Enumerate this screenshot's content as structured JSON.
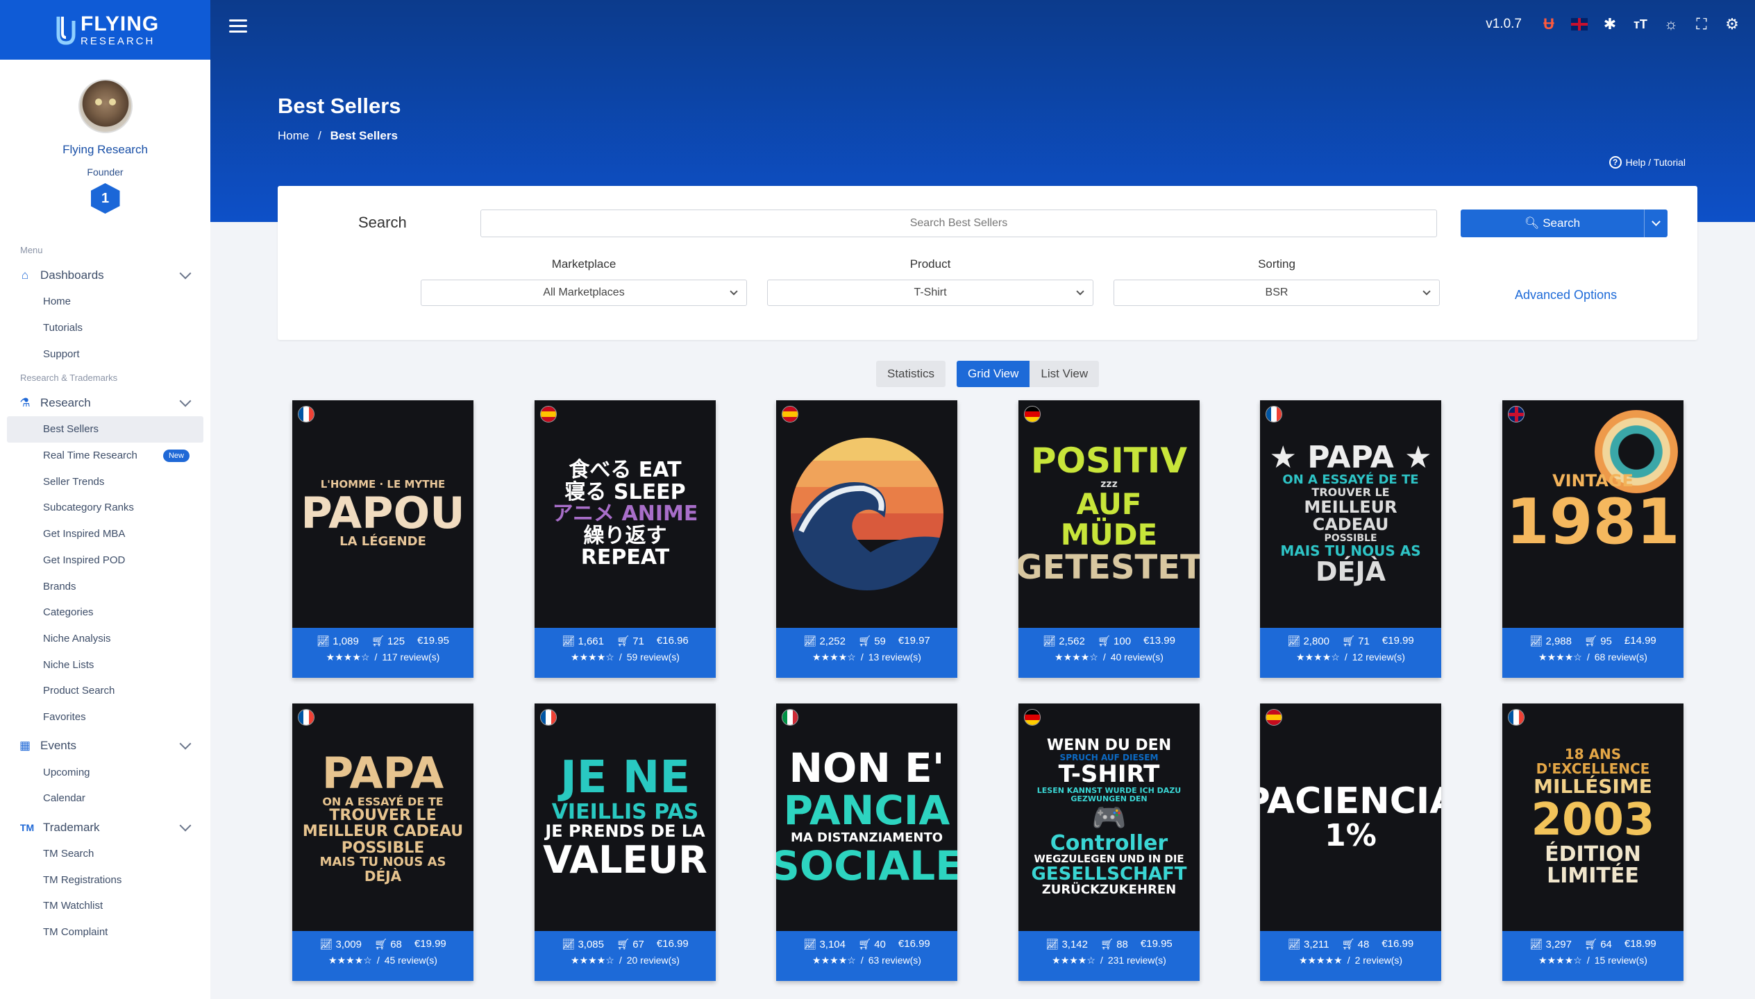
{
  "brand": {
    "line1": "FLYING",
    "line2": "RESEARCH"
  },
  "profile": {
    "name": "Flying Research",
    "role": "Founder",
    "level": "1"
  },
  "sidebar": {
    "menu_caption": "Menu",
    "dashboards": {
      "label": "Dashboards",
      "items": [
        "Home",
        "Tutorials",
        "Support"
      ]
    },
    "research_caption": "Research & Trademarks",
    "research": {
      "label": "Research",
      "items": [
        "Best Sellers",
        "Real Time Research",
        "Seller Trends",
        "Subcategory Ranks",
        "Get Inspired MBA",
        "Get Inspired POD",
        "Brands",
        "Categories",
        "Niche Analysis",
        "Niche Lists",
        "Product Search",
        "Favorites"
      ],
      "new_badge": "New"
    },
    "events": {
      "label": "Events",
      "items": [
        "Upcoming",
        "Calendar"
      ]
    },
    "trademark": {
      "icon": "TM",
      "label": "Trademark",
      "items": [
        "TM Search",
        "TM Registrations",
        "TM Watchlist",
        "TM Complaint"
      ]
    }
  },
  "topbar": {
    "version": "v1.0.7"
  },
  "page": {
    "title": "Best Sellers",
    "breadcrumb_home": "Home",
    "breadcrumb_sep": "/",
    "breadcrumb_current": "Best Sellers",
    "help": "Help / Tutorial"
  },
  "search": {
    "label": "Search",
    "placeholder": "Search Best Sellers",
    "button": "Search",
    "marketplace_label": "Marketplace",
    "marketplace_value": "All Marketplaces",
    "product_label": "Product",
    "product_value": "T-Shirt",
    "sorting_label": "Sorting",
    "sorting_value": "BSR",
    "advanced": "Advanced Options"
  },
  "views": {
    "statistics": "Statistics",
    "grid": "Grid View",
    "list": "List View"
  },
  "products": [
    {
      "flag": "fr",
      "bsr": "1,089",
      "sales": "125",
      "price": "€19.95",
      "stars": "★★★★☆",
      "reviews": "117 review(s)",
      "art": [
        "L'HOMME · LE MYTHE",
        "PAPOU",
        "LA LÉGENDE"
      ]
    },
    {
      "flag": "es",
      "bsr": "1,661",
      "sales": "71",
      "price": "€16.96",
      "stars": "★★★★☆",
      "reviews": "59 review(s)",
      "art": [
        "食べる EAT",
        "寝る SLEEP",
        "アニメ ANIME",
        "繰り返す REPEAT"
      ]
    },
    {
      "flag": "es",
      "bsr": "2,252",
      "sales": "59",
      "price": "€19.97",
      "stars": "★★★★☆",
      "reviews": "13 review(s)",
      "art": []
    },
    {
      "flag": "de",
      "bsr": "2,562",
      "sales": "100",
      "price": "€13.99",
      "stars": "★★★★☆",
      "reviews": "40 review(s)",
      "art": [
        "POSITIV",
        "zzz",
        "AUF MÜDE",
        "GETESTET"
      ]
    },
    {
      "flag": "fr",
      "bsr": "2,800",
      "sales": "71",
      "price": "€19.99",
      "stars": "★★★★☆",
      "reviews": "12 review(s)",
      "art": [
        "★ PAPA ★",
        "ON A ESSAYÉ DE TE",
        "TROUVER LE",
        "MEILLEUR CADEAU",
        "POSSIBLE",
        "MAIS TU NOUS AS",
        "DÉJÀ"
      ]
    },
    {
      "flag": "uk",
      "bsr": "2,988",
      "sales": "95",
      "price": "£14.99",
      "stars": "★★★★☆",
      "reviews": "68 review(s)",
      "art": [
        "VINTAGE",
        "1981"
      ]
    },
    {
      "flag": "fr",
      "bsr": "3,009",
      "sales": "68",
      "price": "€19.99",
      "stars": "★★★★☆",
      "reviews": "45 review(s)",
      "art": [
        "PAPA",
        "ON A ESSAYÉ DE TE",
        "TROUVER LE",
        "MEILLEUR CADEAU",
        "POSSIBLE",
        "MAIS TU NOUS AS",
        "DÉJÀ"
      ]
    },
    {
      "flag": "fr",
      "bsr": "3,085",
      "sales": "67",
      "price": "€16.99",
      "stars": "★★★★☆",
      "reviews": "20 review(s)",
      "art": [
        "JE NE",
        "VIEILLIS PAS",
        "JE PRENDS DE LA",
        "VALEUR"
      ]
    },
    {
      "flag": "it",
      "bsr": "3,104",
      "sales": "40",
      "price": "€16.99",
      "stars": "★★★★☆",
      "reviews": "63 review(s)",
      "art": [
        "NON E'",
        "PANCIA",
        "MA DISTANZIAMENTO",
        "SOCIALE"
      ]
    },
    {
      "flag": "de",
      "bsr": "3,142",
      "sales": "88",
      "price": "€19.95",
      "stars": "★★★★☆",
      "reviews": "231 review(s)",
      "art": [
        "WENN DU DEN",
        "SPRUCH AUF DIESEM",
        "T-SHIRT",
        "LESEN KANNST WURDE ICH DAZU GEZWUNGEN DEN",
        "🎮",
        "Controller",
        "WEGZULEGEN UND IN DIE",
        "GESELLSCHAFT",
        "ZURÜCKZUKEHREN"
      ]
    },
    {
      "flag": "es",
      "bsr": "3,211",
      "sales": "48",
      "price": "€16.99",
      "stars": "★★★★★",
      "reviews": "2 review(s)",
      "art": [
        "PACIENCIA",
        "1%"
      ]
    },
    {
      "flag": "fr",
      "bsr": "3,297",
      "sales": "64",
      "price": "€18.99",
      "stars": "★★★★☆",
      "reviews": "15 review(s)",
      "art": [
        "18 ANS D'EXCELLENCE",
        "MILLÉSIME",
        "2003",
        "ÉDITION LIMITÉE"
      ]
    }
  ],
  "review_sep": "/",
  "colors": {
    "primary": "#1d6ad8",
    "header_top": "#0c3b8c",
    "header_bottom": "#0d50c8"
  }
}
